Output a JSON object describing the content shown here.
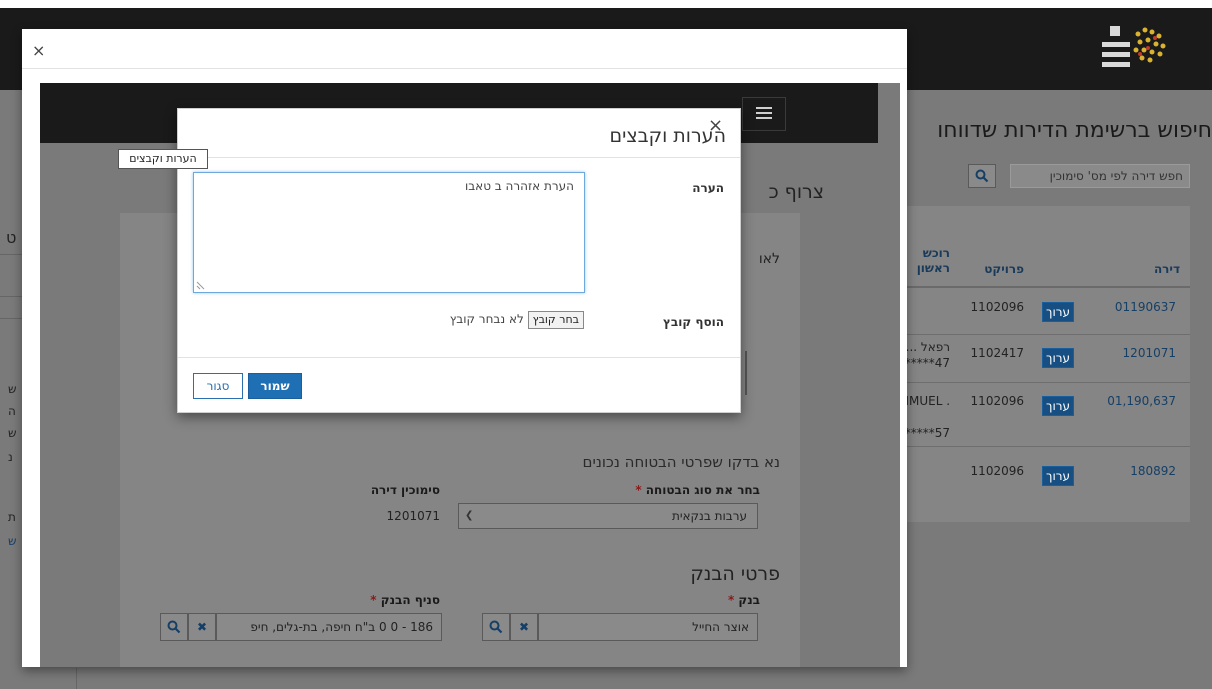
{
  "background_page": {
    "search_title": "חיפוש ברשימת הדירות שדווחו",
    "search_placeholder": "חפש דירה לפי מס' סימוכין",
    "table": {
      "headers": [
        "דירה",
        "פרויקט",
        "רוכש ראשון"
      ],
      "rows": [
        {
          "apartment": "01190637",
          "edit": "ערוך",
          "project": "1102096",
          "buyer": "",
          "buyer_id": ""
        },
        {
          "apartment": "1201071",
          "edit": "ערוך",
          "project": "1102417",
          "buyer": "רפאל ...",
          "buyer_id": "*****47"
        },
        {
          "apartment": "01,190,637",
          "edit": "ערוך",
          "project": "1102096",
          "buyer": "HMUEL ...",
          "buyer_id": "*****57"
        },
        {
          "apartment": "180892",
          "edit": "ערוך",
          "project": "1102096",
          "buyer": "",
          "buyer_id": ""
        }
      ]
    },
    "left_fragments": [
      "ט",
      "ש",
      "ה",
      "ש",
      "נ",
      "ה",
      "ת",
      "ש"
    ]
  },
  "outer_modal": {
    "close_label": "×",
    "form_title_fragment": "צרוף כ",
    "lav_fragment": "לאו",
    "insurance_note": "נא בדקו שפרטי הבטוחה נכונים",
    "insurance_type_label": "בחר את סוג הבטוחה",
    "insurance_type_value": "ערבות בנקאית",
    "ref_label": "סימוכין דירה",
    "ref_value": "1201071",
    "bank_section_title": "פרטי הבנק",
    "bank_label": "בנק",
    "bank_value": "אוצר החייל",
    "branch_label": "סניף הבנק",
    "branch_value": "186 - 0 0 ב\"ח חיפה, בת-גלים, חיפ"
  },
  "inner_modal": {
    "title": "הערות וקבצים",
    "close_label": "×",
    "tooltip": "הערות וקבצים",
    "note_label": "הערה",
    "note_value": "הערת אזהרה ב טאבו",
    "file_label": "הוסף קובץ",
    "file_button": "בחר קובץ",
    "file_status": "לא נבחר קובץ",
    "save_button": "שמור",
    "close_button": "סגור"
  },
  "colors": {
    "accent": "#1f6fb5",
    "link": "#2a6fb0",
    "dark_header": "#1a1a1a",
    "overlay": "#7a7a7a"
  }
}
